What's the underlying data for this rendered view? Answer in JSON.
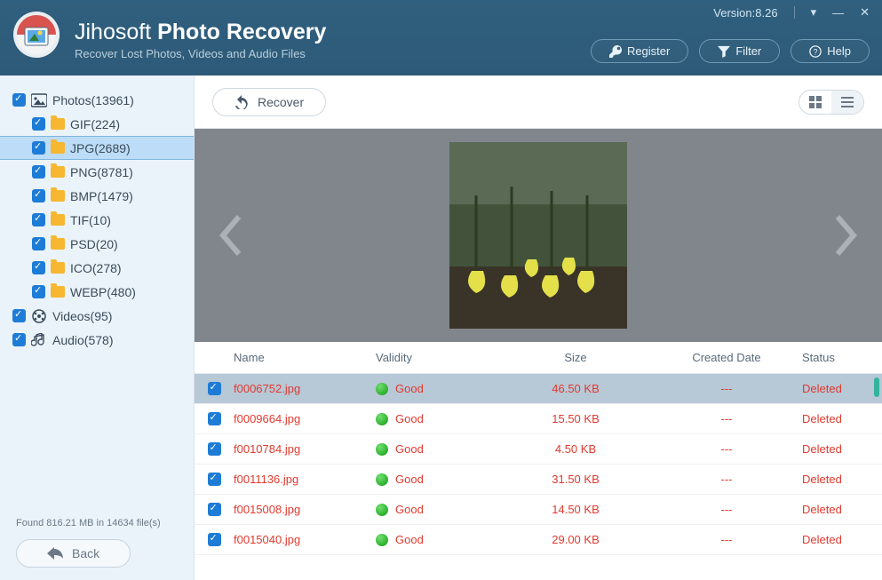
{
  "window": {
    "version_label": "Version:8.26"
  },
  "brand": {
    "name1": "Jihosoft ",
    "name2": "Photo Recovery",
    "tagline": "Recover Lost Photos, Videos and Audio Files"
  },
  "header_buttons": {
    "register": "Register",
    "filter": "Filter",
    "help": "Help"
  },
  "sidebar": {
    "roots": [
      {
        "label": "Photos(13961)",
        "icon": "photo"
      },
      {
        "label": "Videos(95)",
        "icon": "video"
      },
      {
        "label": "Audio(578)",
        "icon": "audio"
      }
    ],
    "photo_children": [
      {
        "label": "GIF(224)"
      },
      {
        "label": "JPG(2689)",
        "selected": true
      },
      {
        "label": "PNG(8781)"
      },
      {
        "label": "BMP(1479)"
      },
      {
        "label": "TIF(10)"
      },
      {
        "label": "PSD(20)"
      },
      {
        "label": "ICO(278)"
      },
      {
        "label": "WEBP(480)"
      }
    ],
    "found_line": "Found 816.21 MB in 14634 file(s)",
    "back": "Back"
  },
  "toolbar": {
    "recover": "Recover"
  },
  "table": {
    "headers": {
      "name": "Name",
      "validity": "Validity",
      "size": "Size",
      "date": "Created Date",
      "status": "Status"
    },
    "rows": [
      {
        "name": "f0006752.jpg",
        "validity": "Good",
        "size": "46.50 KB",
        "date": "---",
        "status": "Deleted",
        "selected": true
      },
      {
        "name": "f0009664.jpg",
        "validity": "Good",
        "size": "15.50 KB",
        "date": "---",
        "status": "Deleted"
      },
      {
        "name": "f0010784.jpg",
        "validity": "Good",
        "size": "4.50 KB",
        "date": "---",
        "status": "Deleted"
      },
      {
        "name": "f0011136.jpg",
        "validity": "Good",
        "size": "31.50 KB",
        "date": "---",
        "status": "Deleted"
      },
      {
        "name": "f0015008.jpg",
        "validity": "Good",
        "size": "14.50 KB",
        "date": "---",
        "status": "Deleted"
      },
      {
        "name": "f0015040.jpg",
        "validity": "Good",
        "size": "29.00 KB",
        "date": "---",
        "status": "Deleted"
      }
    ]
  }
}
